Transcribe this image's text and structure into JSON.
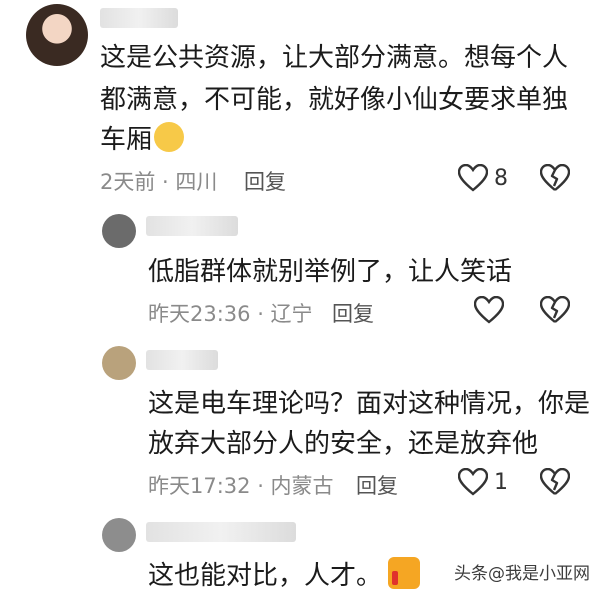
{
  "comments": [
    {
      "text_lines": [
        "这是公共资源，让大部分满意。想每个人",
        "都满意，不可能，就好像小仙女要求单独",
        "车厢"
      ],
      "meta": "2天前 · 四川",
      "reply_label": "回复",
      "like_count": "8",
      "emoji": "thinking-face-emoji"
    },
    {
      "text_lines": [
        "低脂群体就别举例了，让人笑话"
      ],
      "meta": "昨天23:36 · 辽宁",
      "reply_label": "回复",
      "like_count": ""
    },
    {
      "text_lines": [
        "这是电车理论吗？面对这种情况，你是",
        "放弃大部分人的安全，还是放弃他"
      ],
      "meta": "昨天17:32 · 内蒙古",
      "reply_label": "回复",
      "like_count": "1"
    },
    {
      "text_lines": [
        "这也能对比，人才。"
      ],
      "emoji": "thumbs-up-emoji"
    }
  ],
  "watermark": "头条@我是小亚网",
  "colors": {
    "meta_gray": "#8a8a8a",
    "text": "#1b1b1b",
    "background": "#ffffff"
  }
}
